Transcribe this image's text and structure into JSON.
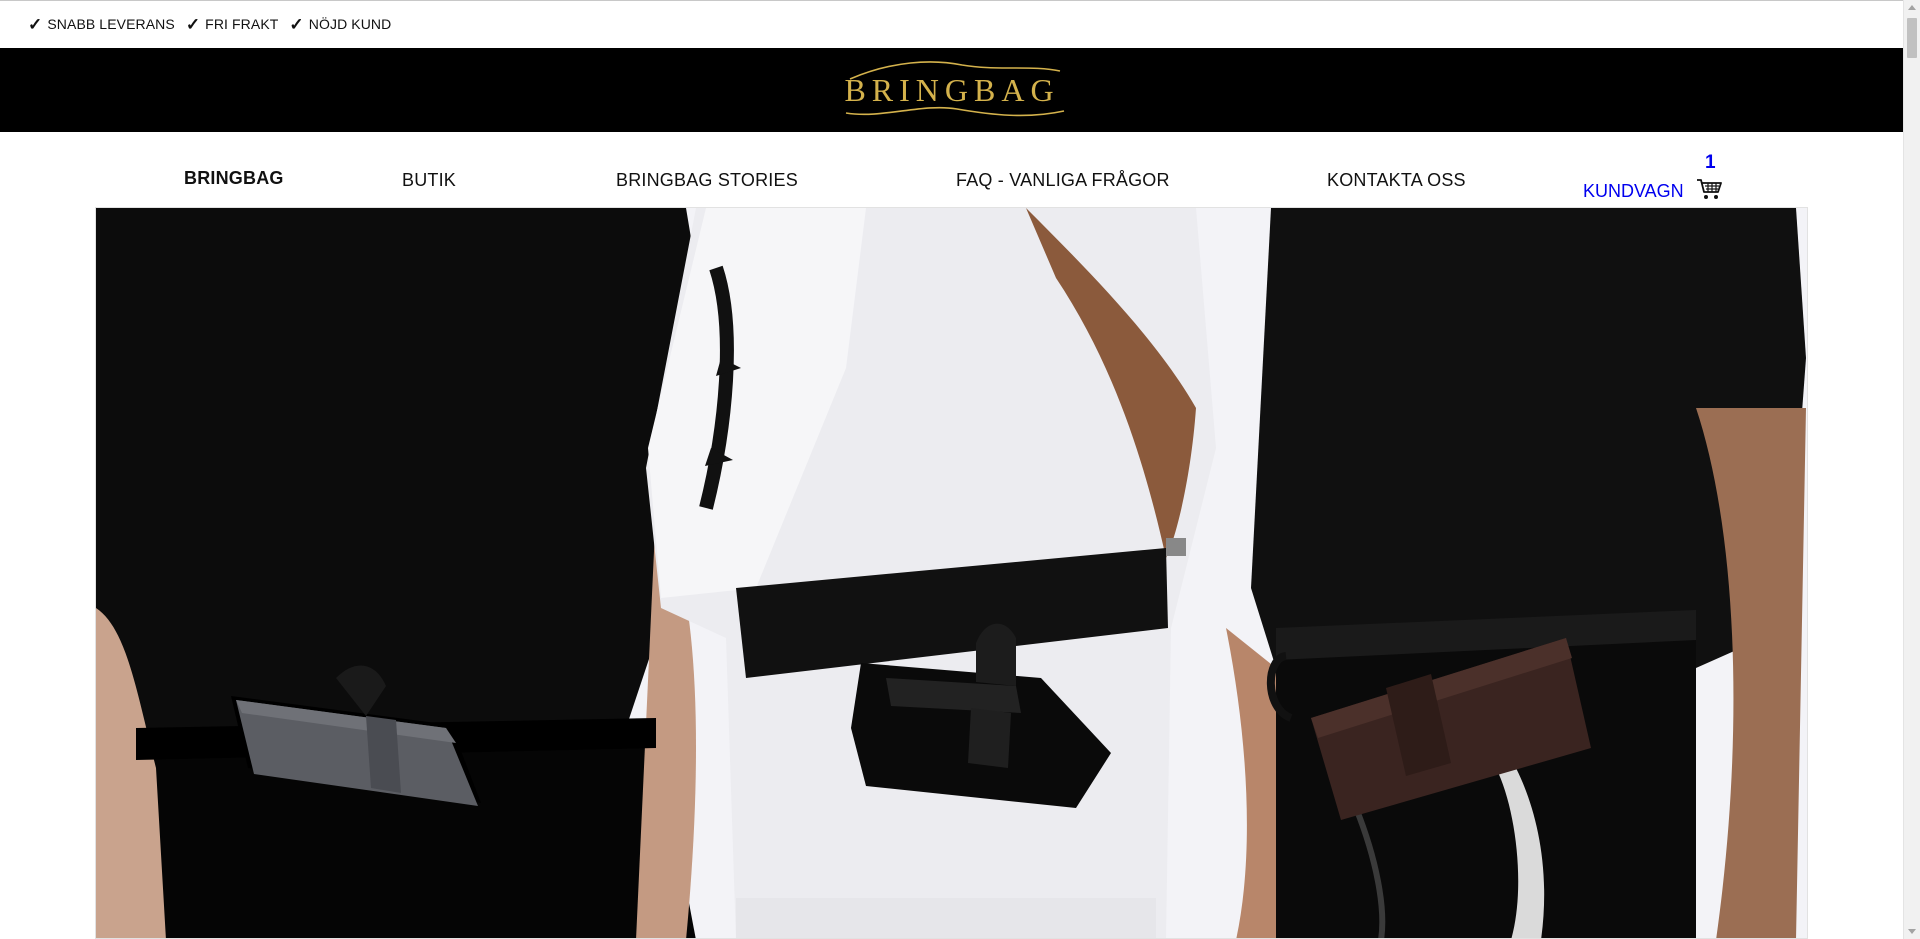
{
  "usp": {
    "items": [
      {
        "icon": "check-icon",
        "label": "SNABB LEVERANS"
      },
      {
        "icon": "check-icon",
        "label": "FRI FRAKT"
      },
      {
        "icon": "check-icon",
        "label": "NÖJD KUND"
      }
    ]
  },
  "brand": {
    "logo_text": "BRINGBAG",
    "band_color": "#000000",
    "logo_color": "#d4b24c"
  },
  "nav": {
    "items": [
      {
        "label": "BRINGBAG",
        "active": true
      },
      {
        "label": "BUTIK"
      },
      {
        "label": "BRINGBAG STORIES"
      },
      {
        "label": "FAQ - VANLIGA FRÅGOR"
      },
      {
        "label": "KONTAKTA OSS"
      }
    ],
    "cart": {
      "label": "KUNDVAGN",
      "count": "1",
      "icon": "shopping-cart-icon"
    }
  },
  "hero": {
    "image": "three-models-wearing-phone-wallet-belt-bags"
  }
}
